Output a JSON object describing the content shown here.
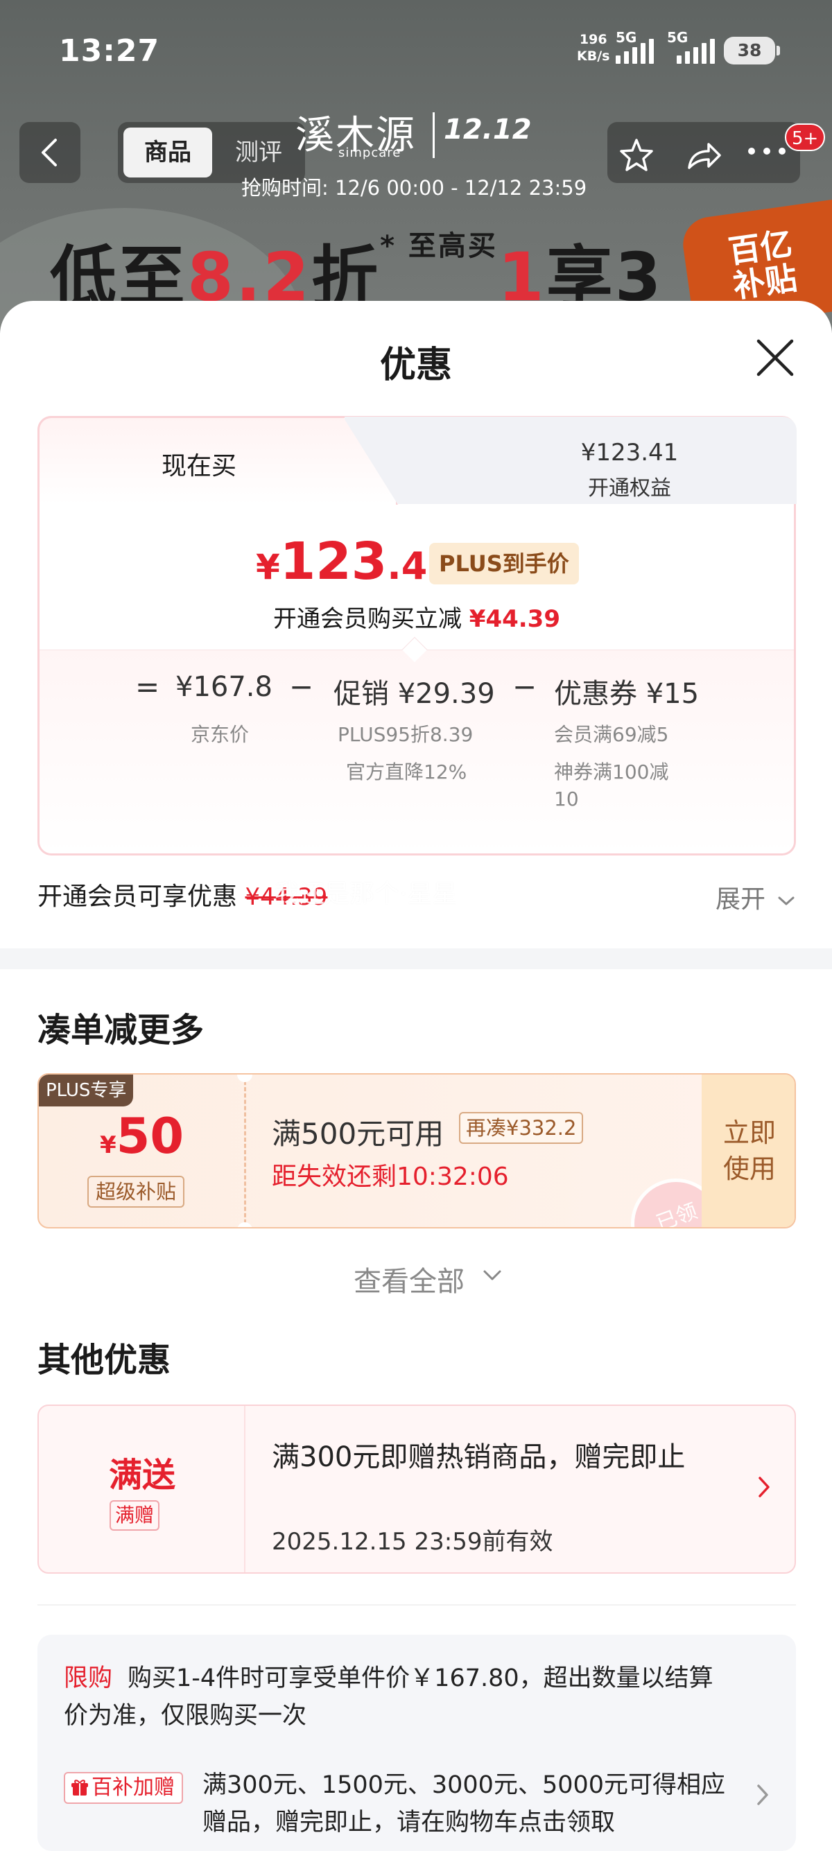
{
  "status": {
    "time": "13:27",
    "net_speed": "196",
    "net_unit": "KB/s",
    "sig1": "5G",
    "sig2": "5G",
    "battery": "38"
  },
  "header": {
    "tab_goods": "商品",
    "tab_review": "测评",
    "brand_cn": "溪木源",
    "brand_en": "simpcare",
    "event": "12.12",
    "sale_time": "抢购时间: 12/6 00:00 - 12/12 23:59",
    "promo_a": "低至",
    "promo_b": "8.2",
    "promo_c": "折",
    "promo_d": "* 至高买",
    "promo_e": "1",
    "promo_f": "享3",
    "subsidy_a": "百亿",
    "subsidy_b": "补贴",
    "badge": "5+"
  },
  "sheet": {
    "title": "优惠",
    "tab_now": "现在买",
    "tab_alt_price": "¥123.41",
    "tab_alt_sub": "开通权益",
    "price_symbol": "¥",
    "price_int": "123",
    "price_dec": ".41",
    "plus_tag": "PLUS到手价",
    "member_save_label": "开通会员购买立减",
    "member_save_value": "¥44.39",
    "breakdown": {
      "eq": "=",
      "jd_price": "¥167.8",
      "jd_label": "京东价",
      "minus1": "−",
      "promo": "促销 ¥29.39",
      "promo_l1": "PLUS95折8.39",
      "promo_l2": "官方直降12%",
      "minus2": "−",
      "coupon": "优惠券 ¥15",
      "coupon_l1": "会员满69减5",
      "coupon_l2": "神券满100减",
      "coupon_l3": "10"
    },
    "member_row_label": "开通会员可享优惠",
    "member_row_value": "¥44.39",
    "watermark": "我还是那个·星星",
    "expand": "展开"
  },
  "more": {
    "title": "凑单减更多",
    "plus_only": "PLUS专享",
    "amt_symbol": "¥",
    "amt": "50",
    "amt_tag": "超级补贴",
    "condition": "满500元可用",
    "extra": "再凑¥332.2",
    "countdown": "距失效还剩10:32:06",
    "stamp": "已领",
    "use_a": "立即",
    "use_b": "使用",
    "view_all": "查看全部"
  },
  "other": {
    "title": "其他优惠",
    "gift_main": "满送",
    "gift_sub": "满赠",
    "gift_desc": "满300元即赠热销商品，赠完即止",
    "gift_date": "2025.12.15 23:59前有效",
    "limit_tag": "限购",
    "limit_text": "购买1-4件时可享受单件价￥167.80，超出数量以结算价为准，仅限购买一次",
    "bb_tag": "百补加赠",
    "bb_text": "满300元、1500元、3000元、5000元可得相应赠品，赠完即止，请在购物车点击领取"
  }
}
